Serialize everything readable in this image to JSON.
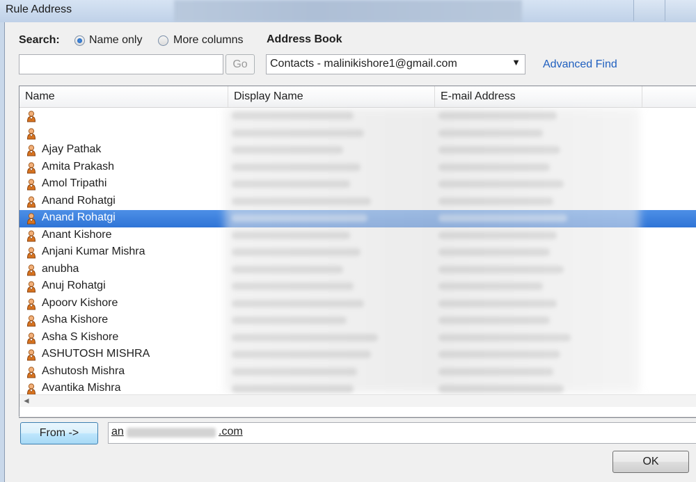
{
  "window": {
    "title": "Rule Address"
  },
  "search": {
    "label": "Search:",
    "option_name_only": "Name only",
    "option_more_columns": "More columns",
    "selected": "Name only",
    "input_value": "",
    "go_label": "Go"
  },
  "address_book": {
    "label": "Address Book",
    "selected": "Contacts - malinikishore1@gmail.com",
    "advanced_find": "Advanced Find"
  },
  "table": {
    "columns": [
      "Name",
      "Display Name",
      "E-mail Address"
    ],
    "rows": [
      {
        "name": ""
      },
      {
        "name": ""
      },
      {
        "name": "Ajay Pathak"
      },
      {
        "name": "Amita Prakash"
      },
      {
        "name": "Amol Tripathi"
      },
      {
        "name": "Anand Rohatgi"
      },
      {
        "name": "Anand Rohatgi",
        "selected": true
      },
      {
        "name": "Anant Kishore"
      },
      {
        "name": "Anjani Kumar Mishra"
      },
      {
        "name": "anubha"
      },
      {
        "name": "Anuj Rohatgi"
      },
      {
        "name": "Apoorv Kishore"
      },
      {
        "name": "Asha Kishore"
      },
      {
        "name": "Asha S Kishore"
      },
      {
        "name": "ASHUTOSH MISHRA"
      },
      {
        "name": "Ashutosh Mishra"
      },
      {
        "name": "Avantika Mishra"
      }
    ]
  },
  "from": {
    "button_label": "From ->",
    "value_prefix": "an",
    "value_suffix": ".com"
  },
  "ok_label": "OK",
  "colors": {
    "selection": "#3278d8",
    "link": "#1f5fbf"
  }
}
